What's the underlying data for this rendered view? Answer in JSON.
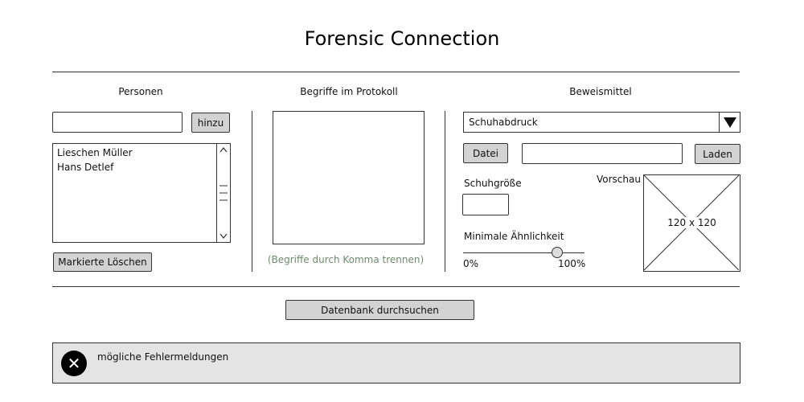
{
  "app": {
    "title": "Forensic Connection"
  },
  "personen": {
    "heading": "Personen",
    "input_value": "",
    "add_label": "hinzu",
    "items": [
      "Lieschen Müller",
      "Hans Detlef"
    ],
    "delete_label": "Markierte Löschen"
  },
  "begriffe": {
    "heading": "Begriffe im Protokoll",
    "textarea_value": "",
    "hint": "(Begriffe durch Komma trennen)"
  },
  "beweismittel": {
    "heading": "Beweismittel",
    "select_value": "Schuhabdruck",
    "file_button_label": "Datei",
    "file_path_value": "",
    "load_label": "Laden",
    "shoe_size_label": "Schuhgröße",
    "shoe_size_value": "",
    "similarity_label": "Minimale Ähnlichkeit",
    "slider_min_label": "0%",
    "slider_max_label": "100%",
    "slider_value_fraction": 0.8,
    "preview_label": "Vorschau",
    "preview_placeholder": "120 x 120"
  },
  "search": {
    "label": "Datenbank durchsuchen"
  },
  "messages": {
    "text": "mögliche Fehlermeldungen",
    "icon": "error-close-icon"
  }
}
